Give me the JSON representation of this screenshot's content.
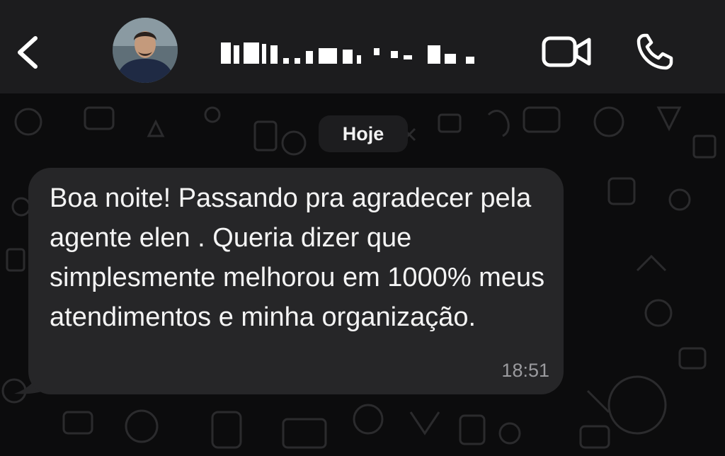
{
  "header": {
    "back_icon": "chevron-left-icon",
    "contact_name": "",
    "video_icon": "video-camera-icon",
    "call_icon": "phone-icon"
  },
  "chat": {
    "date_separator": "Hoje",
    "messages": [
      {
        "text": "Boa noite! Passando pra agradecer pela agente elen . Queria dizer que simplesmente melhorou em 1000% meus atendimentos e minha organização.",
        "time": "18:51"
      }
    ]
  },
  "colors": {
    "header_bg": "#1c1c1e",
    "chat_bg": "#0c0c0d",
    "bubble_bg": "#262628",
    "text": "#f4f4f4",
    "timestamp": "#9a9a9e"
  }
}
